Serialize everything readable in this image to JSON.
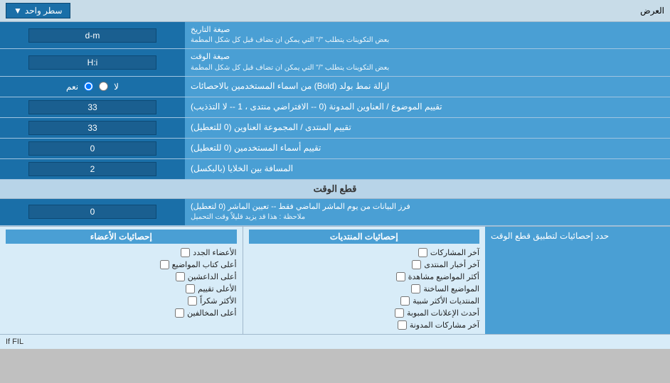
{
  "top": {
    "label": "العرض",
    "dropdown_label": "سطر واحد",
    "dropdown_arrow": "▼"
  },
  "rows": [
    {
      "id": "date_format",
      "label": "صيغة التاريخ\nبعض التكوينات يتطلب \"/\" التي يمكن ان تضاف قبل كل شكل المطمة",
      "input_value": "d-m",
      "input_type": "text"
    },
    {
      "id": "time_format",
      "label": "صيغة الوقت\nبعض التكوينات يتطلب \"/\" التي يمكن ان تضاف قبل كل شكل المطمة",
      "input_value": "H:i",
      "input_type": "text"
    },
    {
      "id": "bold_remove",
      "label": "ازالة نمط بولد (Bold) من اسماء المستخدمين بالاحصائات",
      "radio_yes": "نعم",
      "radio_no": "لا",
      "radio_selected": "no",
      "input_type": "radio"
    },
    {
      "id": "topics_count",
      "label": "تقييم الموضوع / العناوين المدونة (0 -- الافتراضي منتدى ، 1 -- لا التذذيب)",
      "input_value": "33",
      "input_type": "text"
    },
    {
      "id": "forum_group",
      "label": "تقييم المنتدى / المجموعة العناوين (0 للتعطيل)",
      "input_value": "33",
      "input_type": "text"
    },
    {
      "id": "users_names",
      "label": "تقييم أسماء المستخدمين (0 للتعطيل)",
      "input_value": "0",
      "input_type": "text"
    },
    {
      "id": "cell_spacing",
      "label": "المسافة بين الخلايا (بالبكسل)",
      "input_value": "2",
      "input_type": "text"
    }
  ],
  "time_cut_section": {
    "header": "قطع الوقت",
    "row_label": "فرز البيانات من يوم الماشر الماضي فقط -- تعيين الماشر (0 لتعطيل)\nملاحظة : هذا قد يزيد قليلاً وقت التحميل",
    "input_value": "0",
    "input_type": "text"
  },
  "stats_section": {
    "limit_label": "حدد إحصائيات لتطبيق قطع الوقت",
    "col1_header": "إحصائيات المنتديات",
    "col1_items": [
      "آخر المشاركات",
      "آخر أخبار المنتدى",
      "أكثر المواضيع مشاهدة",
      "المواضيع الساخنة",
      "المنتديات الأكثر شبية",
      "أحدث الإعلانات المبوبة",
      "آخر مشاركات المدونة"
    ],
    "col2_header": "إحصائيات الأعضاء",
    "col2_items": [
      "الأعضاء الجدد",
      "أعلى كتاب المواضيع",
      "أعلى الداعشين",
      "الأعلى تقييم",
      "الأكثر شكراً",
      "أعلى المخالفين"
    ]
  },
  "note_text": "If FIL"
}
